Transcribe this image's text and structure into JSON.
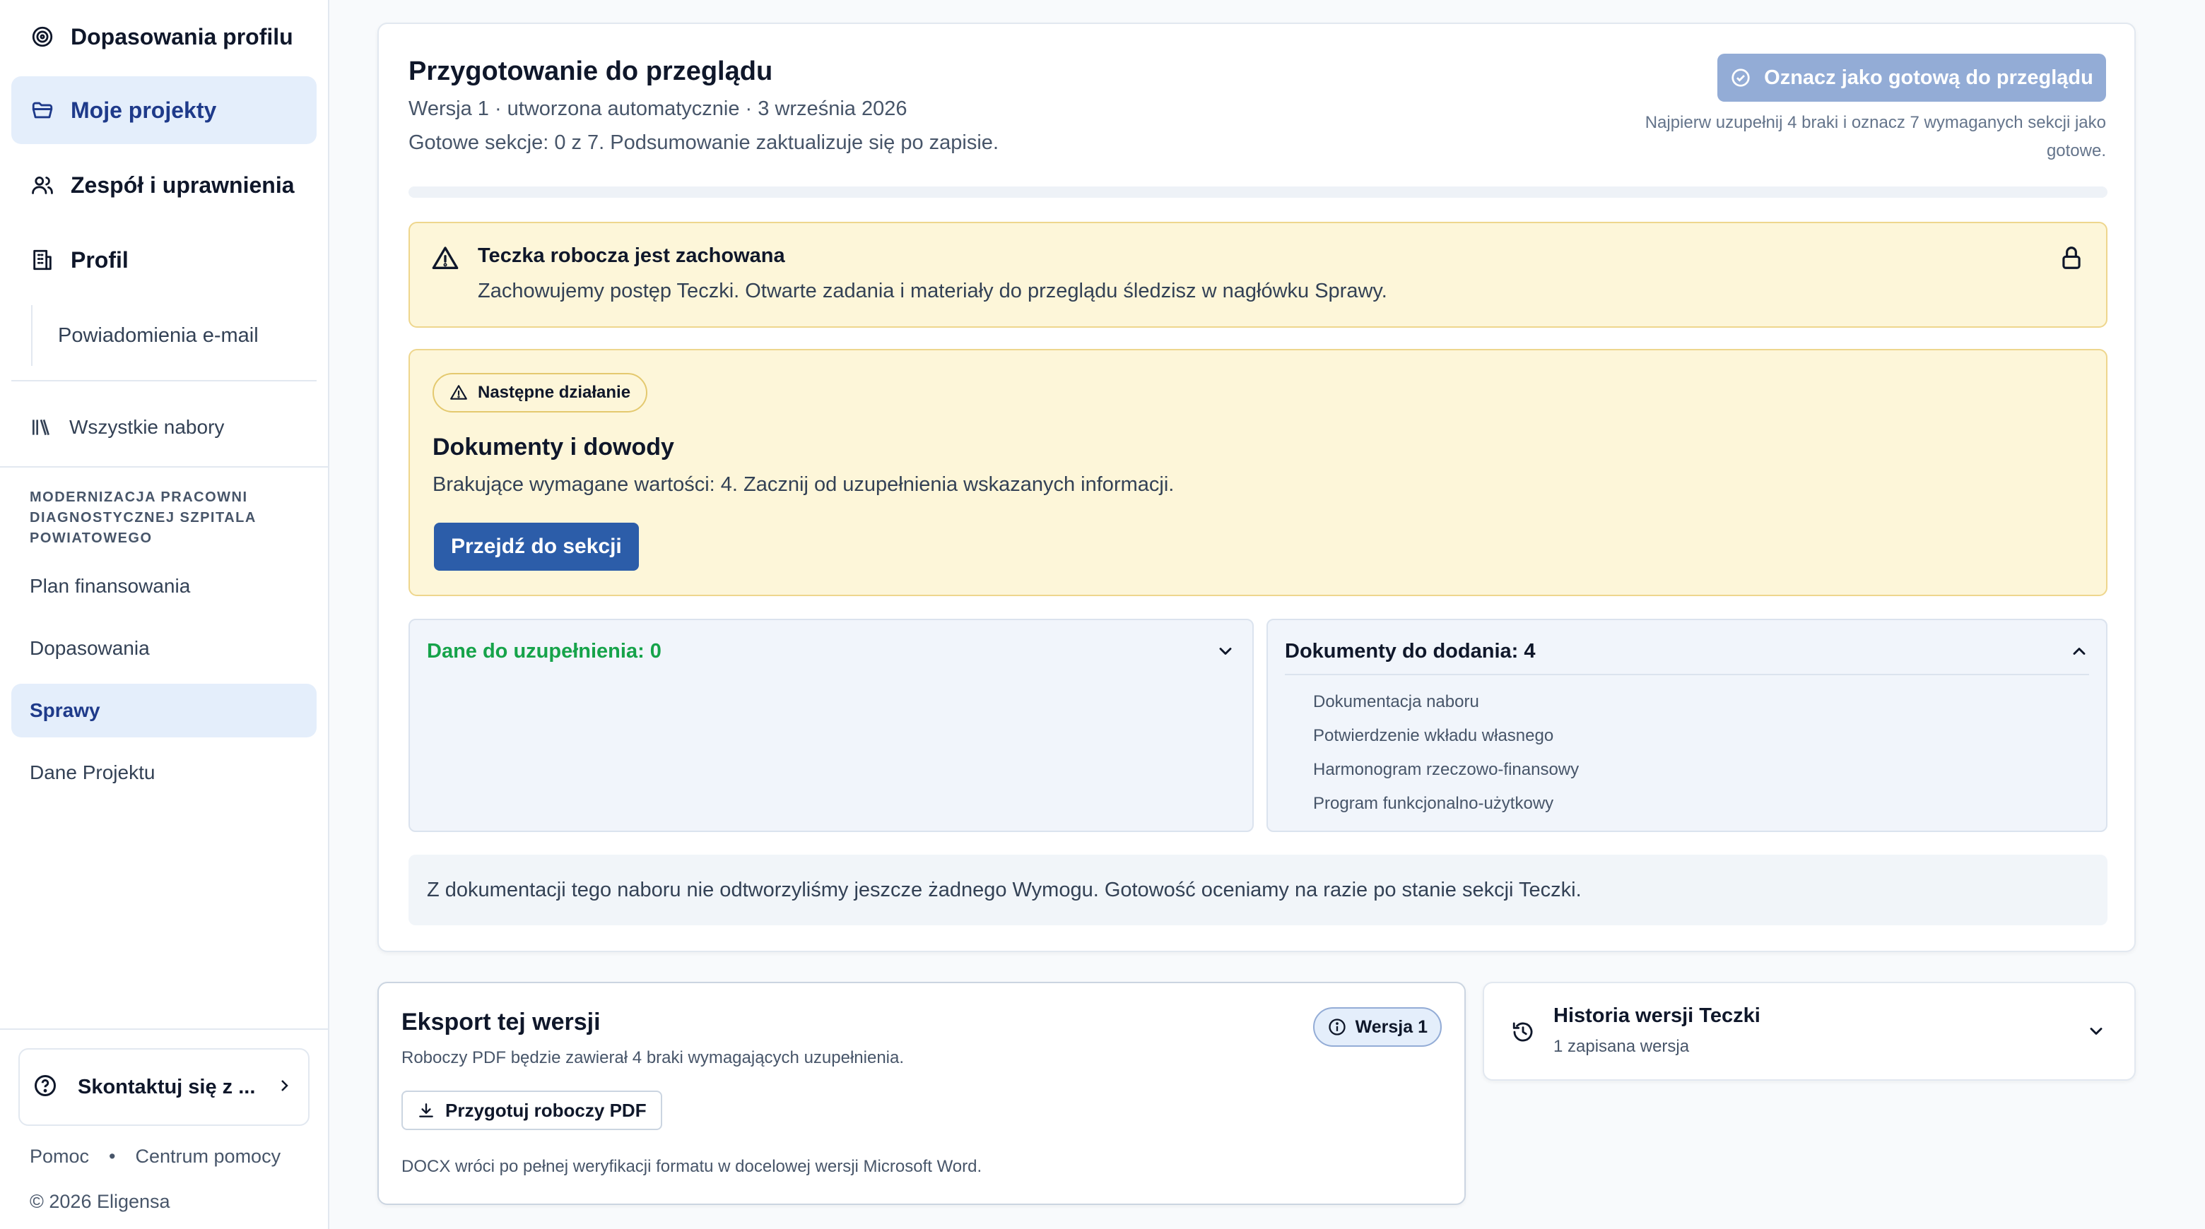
{
  "sidebar": {
    "nav": [
      {
        "label": "Dopasowania profilu",
        "icon": "target-icon",
        "active": false
      },
      {
        "label": "Moje projekty",
        "icon": "folder-icon",
        "active": true
      },
      {
        "label": "Zespół i uprawnienia",
        "icon": "users-icon",
        "active": false
      },
      {
        "label": "Profil",
        "icon": "building-icon",
        "active": false
      }
    ],
    "sub_item": "Powiadomienia e-mail",
    "all_calls": {
      "label": "Wszystkie nabory",
      "icon": "library-icon"
    },
    "project_title": "MODERNIZACJA PRACOWNI DIAGNOSTYCZNEJ SZPITALA POWIATOWEGO",
    "project_links": [
      {
        "label": "Plan finansowania",
        "active": false
      },
      {
        "label": "Dopasowania",
        "active": false
      },
      {
        "label": "Sprawy",
        "active": true
      },
      {
        "label": "Dane Projektu",
        "active": false
      }
    ],
    "contact": {
      "label": "Skontaktuj się z ...",
      "icon": "help-circle-icon"
    },
    "footer": {
      "help": "Pomoc",
      "separator": "•",
      "help_center": "Centrum pomocy",
      "copyright": "© 2026 Eligensa"
    }
  },
  "review": {
    "title": "Przygotowanie do przeglądu",
    "meta": "Wersja 1 · utworzona automatycznie · 3 września 2026",
    "status": "Gotowe sekcje: 0 z 7. Podsumowanie zaktualizuje się po zapisie.",
    "ready_button": "Oznacz jako gotową do przeglądu",
    "ready_hint": "Najpierw uzupełnij 4 braki i oznacz 7 wymaganych sekcji jako gotowe.",
    "progress_fraction": 0
  },
  "alert": {
    "title": "Teczka robocza jest zachowana",
    "body": "Zachowujemy postęp Teczki. Otwarte zadania i materiały do przeglądu śledzisz w nagłówku Sprawy."
  },
  "next_action": {
    "badge": "Następne działanie",
    "title": "Dokumenty i dowody",
    "body": "Brakujące wymagane wartości: 4. Zacznij od uzupełnienia wskazanych informacji.",
    "button": "Przejdź do sekcji"
  },
  "panels": {
    "data": {
      "title": "Dane do uzupełnienia: 0",
      "expanded": false
    },
    "documents": {
      "title": "Dokumenty do dodania: 4",
      "expanded": true,
      "items": [
        "Dokumentacja naboru",
        "Potwierdzenie wkładu własnego",
        "Harmonogram rzeczowo-finansowy",
        "Program funkcjonalno-użytkowy"
      ]
    }
  },
  "note": "Z dokumentacji tego naboru nie odtworzyliśmy jeszcze żadnego Wymogu. Gotowość oceniamy na razie po stanie sekcji Teczki.",
  "export": {
    "title": "Eksport tej wersji",
    "desc": "Roboczy PDF będzie zawierał 4 braki wymagających uzupełnienia.",
    "version_badge": "Wersja 1",
    "pdf_button": "Przygotuj roboczy PDF",
    "note": "DOCX wróci po pełnej weryfikacji formatu w docelowej wersji Microsoft Word."
  },
  "history": {
    "title": "Historia wersji Teczki",
    "sub": "1 zapisana wersja"
  },
  "colors": {
    "accent": "#2c5da9",
    "accent_disabled": "#93acd6",
    "warning_bg": "#fdf6d9",
    "warning_border": "#eed68d",
    "success_text": "#16a34a",
    "active_nav_bg": "#e4eefb"
  }
}
